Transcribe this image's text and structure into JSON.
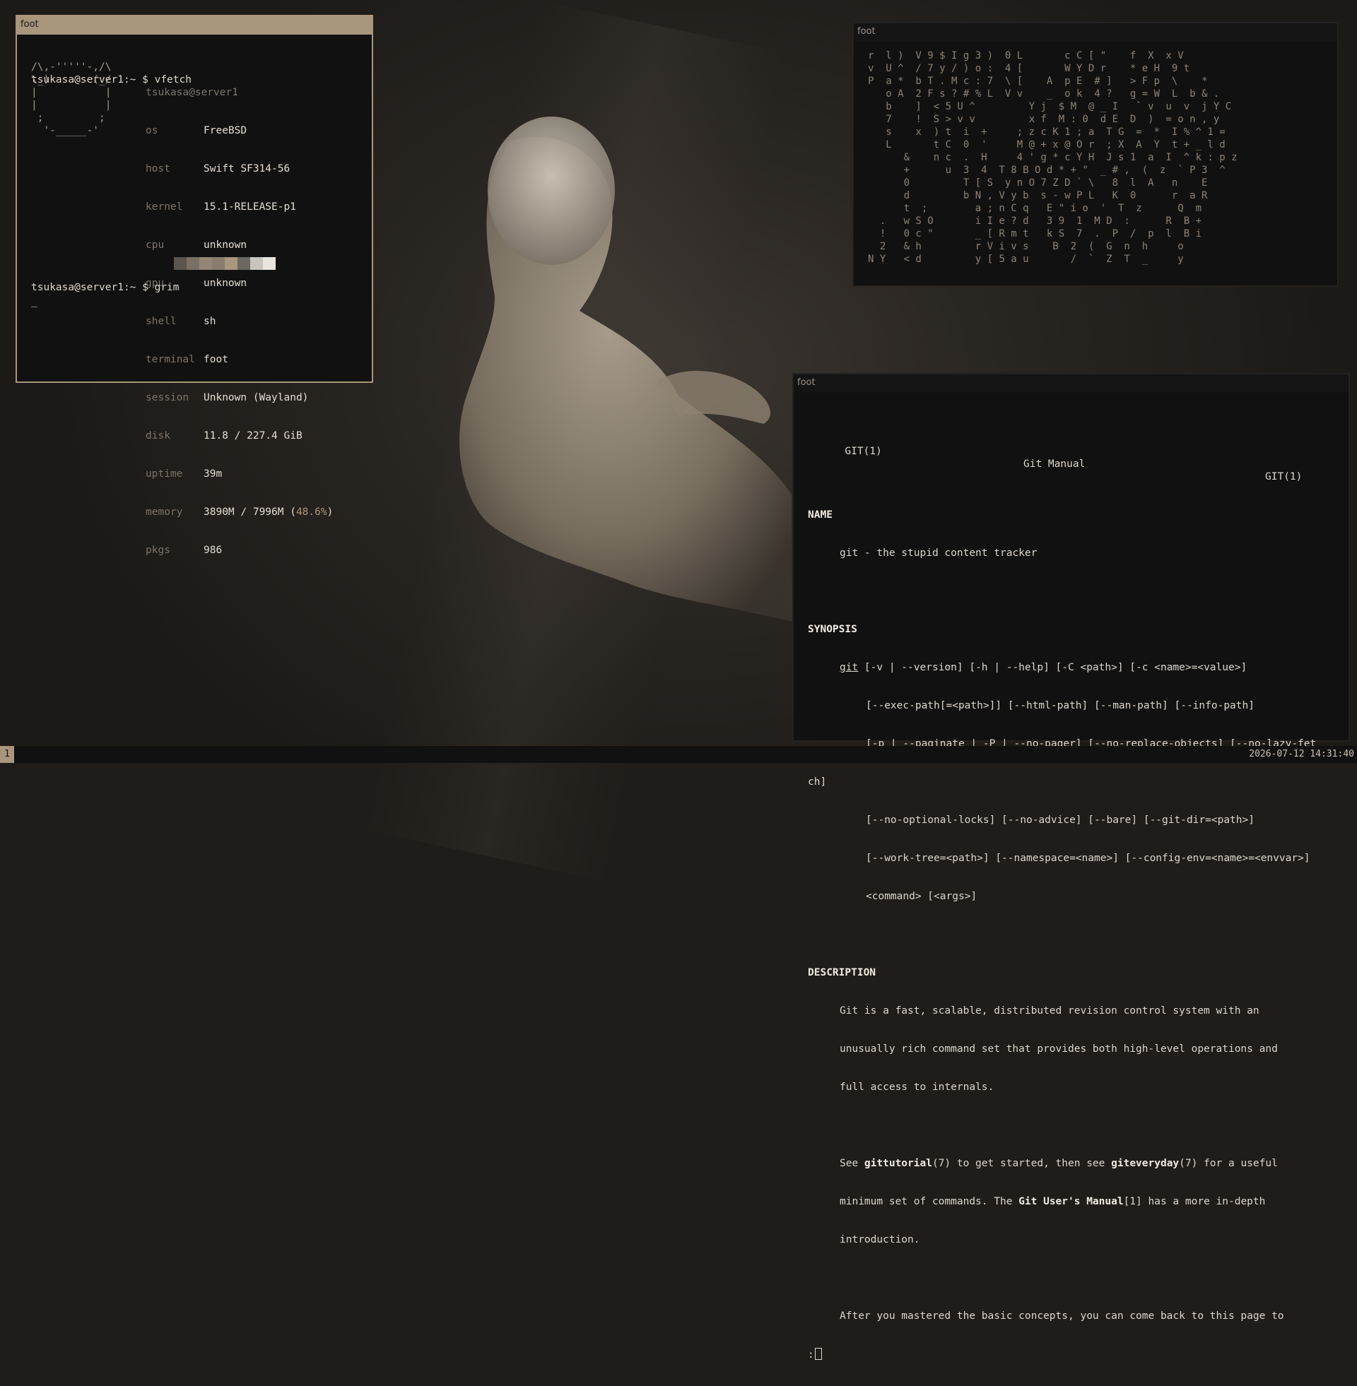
{
  "windows": {
    "fetch": {
      "title": "foot",
      "prompt1": "tsukasa@server1:~ $ vfetch",
      "logo": [
        "/\\,-'''''-,/\\",
        "\\_)       (_/",
        "|           |",
        "|           |",
        " ;         ;",
        "  '-_____-'"
      ],
      "userhost": "tsukasa@server1",
      "info": [
        {
          "key": "os",
          "value": "FreeBSD"
        },
        {
          "key": "host",
          "value": "Swift SF314-56"
        },
        {
          "key": "kernel",
          "value": "15.1-RELEASE-p1"
        },
        {
          "key": "cpu",
          "value": "unknown"
        },
        {
          "key": "gpu",
          "value": "unknown"
        },
        {
          "key": "shell",
          "value": "sh"
        },
        {
          "key": "terminal",
          "value": "foot"
        },
        {
          "key": "session",
          "value": "Unknown (Wayland)"
        },
        {
          "key": "disk",
          "value": "11.8 / 227.4 GiB"
        },
        {
          "key": "uptime",
          "value": "39m"
        }
      ],
      "memory": {
        "key": "memory",
        "value": "3890M / 7996M (",
        "percent": "48.6%",
        "close": ")"
      },
      "pkgs": {
        "key": "pkgs",
        "value": "986"
      },
      "palette": [
        "#5c554d",
        "#7a7066",
        "#948676",
        "#8a7d6e",
        "#a8967d",
        "#6b6762",
        "#c9c4be",
        "#e8e4de"
      ],
      "prompt2": "tsukasa@server1:~ $ grim",
      "cursor": "_"
    },
    "matrix": {
      "title": "foot",
      "rows": [
        "r  l )  V 9 $ I g 3 )  0 L       c C [ \"    f  X  x V",
        "v  U ^  / 7 y / ) o :  4 [       W Y D r    * e H  9 t",
        "P  a *  b T . M c : 7  \\ [    A  p E  # ]   > F p  \\    *",
        "   o A  2 F s ? # % L  V v    _  o k  4 ?   g = W  L  b & .",
        "   b    ]  < 5 U ^         Y j  $ M  @ _ I   ` v  u  v  j Y C",
        "   7    !  S > v v         x f  M : 0  d E  D  )  = o n , y",
        "   s    x  ) t  i  +     ; z c K 1 ; a  T G  =  *  I % ^ 1 =",
        "   L       t C  0  '     M @ + x @ O r  ; X  A  Y  t + _ l d",
        "      &    n c  .  H     4 ' g * c Y H  J s 1  a  I  ^ k : p z",
        "      +      u  3  4  T 8 B O d * + \"  _ # ,  (  z  ` P 3  ^",
        "      0         T [ S  y n O 7 Z D ` \\   8  l  A   n    E",
        "      d         b N , V y b  s - w P L   K  0      r  a R",
        "      t  ;        a ; n C q   E \" i o  '  T  z      Q  m",
        "  .   w S O       i I e ? d   3 9  1  M D  :      R  B +",
        "  !   0 c \"       _ [ R m t   k S  7  .  P  /  p  l  B i",
        "  2   & h         r V i v s    B  2  (  G  n  h     o",
        "N Y   < d         y [ 5 a u       /  `  Z  T  _     y"
      ]
    },
    "man": {
      "title": "foot",
      "header_left": "GIT(1)",
      "header_center": "Git Manual",
      "header_right": "GIT(1)",
      "name_heading": "NAME",
      "name_text": "git - the stupid content tracker",
      "synopsis_heading": "SYNOPSIS",
      "synopsis_cmd": "git",
      "synopsis_lines": [
        " [-v | --version] [-h | --help] [-C <path>] [-c <name>=<value>]",
        "[--exec-path[=<path>]] [--html-path] [--man-path] [--info-path]",
        "[-p | --paginate | -P | --no-pager] [--no-replace-objects] [--no-lazy-fet",
        "ch]",
        "[--no-optional-locks] [--no-advice] [--bare] [--git-dir=<path>]",
        "[--work-tree=<path>] [--namespace=<name>] [--config-env=<name>=<envvar>]",
        "<command> [<args>]"
      ],
      "description_heading": "DESCRIPTION",
      "desc_lines": [
        "Git is a fast, scalable, distributed revision control system with an",
        "unusually rich command set that provides both high-level operations and",
        "full access to internals."
      ],
      "see_prefix": "See ",
      "see_gittutorial": "gittutorial",
      "see_mid1": "(7) to get started, then see ",
      "see_giteveryday": "giteveryday",
      "see_end1": "(7) for a useful",
      "min_prefix": "minimum set of commands. The ",
      "min_bold": "Git User's Manual",
      "min_end": "[1] has a more in-depth",
      "intro": "introduction.",
      "after": "After you mastered the basic concepts, you can come back to this page to",
      "pager_prompt": ":"
    }
  },
  "statusbar": {
    "workspace": "1",
    "clock": "2026-07-12 14:31:40"
  }
}
